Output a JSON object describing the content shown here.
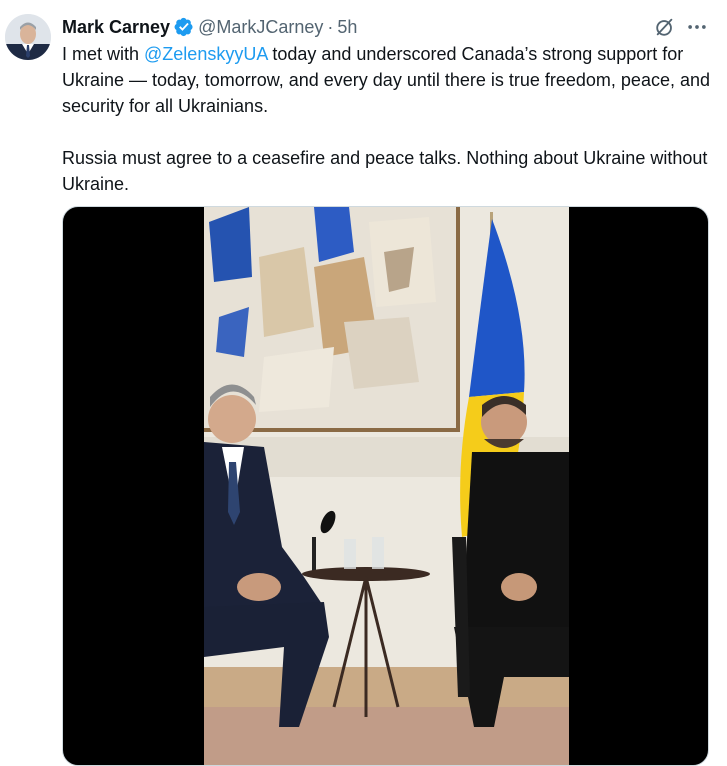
{
  "tweet": {
    "author_name": "Mark Carney",
    "handle": "@MarkJCarney",
    "separator": "·",
    "time": "5h",
    "verified": true,
    "paragraph1": {
      "before": "I met with ",
      "mention": "@ZelenskyyUA",
      "after": " today and underscored Canada’s strong support for Ukraine — today, tomorrow, and every day until there is true freedom, peace, and security for all Ukrainians."
    },
    "paragraph2": "Russia must agree to a ceasefire and peace talks. Nothing about Ukraine without Ukraine."
  },
  "icons": {
    "verified": "verified-badge-icon",
    "grok": "grok-icon",
    "more": "more-options-icon"
  },
  "colors": {
    "text": "#0f1419",
    "secondary": "#536471",
    "accent": "#1d9bf0",
    "flag_blue": "#1f56c8",
    "flag_yellow": "#f5cc1a"
  }
}
